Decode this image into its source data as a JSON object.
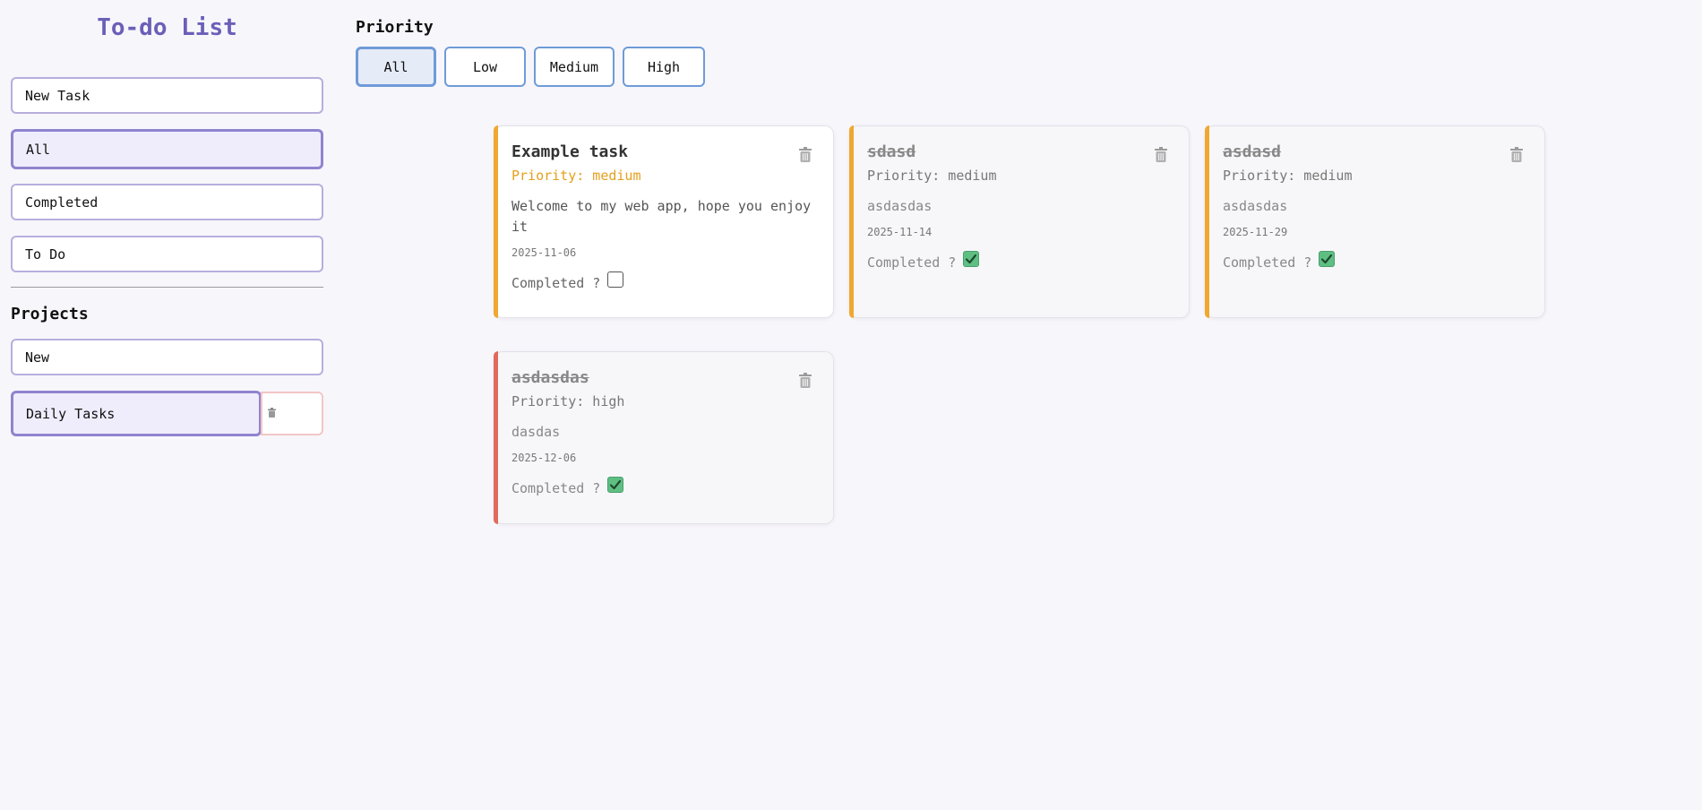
{
  "sidebar": {
    "title": "To-do List",
    "new_task": "New Task",
    "filters": [
      "All",
      "Completed",
      "To Do"
    ],
    "projects_title": "Projects",
    "new_project": "New",
    "project": {
      "label": "Daily Tasks",
      "delete_icon": "trash-icon"
    }
  },
  "priority": {
    "title": "Priority",
    "options": [
      "All",
      "Low",
      "Medium",
      "High"
    ],
    "selected": "All"
  },
  "tasks": [
    {
      "title": "Example task",
      "priority": "Priority: medium",
      "description": "Welcome to my web app, hope you enjoy it",
      "date": "2025-11-06",
      "completed_label": "Completed ?",
      "completed": false,
      "accent": "#f0a830"
    },
    {
      "title": "sdasd",
      "priority": "Priority: medium",
      "description": "asdasdas",
      "date": "2025-11-14",
      "completed_label": "Completed ?",
      "completed": true,
      "accent": "#f0a830"
    },
    {
      "title": "asdasd",
      "priority": "Priority: medium",
      "description": "asdasdas",
      "date": "2025-11-29",
      "completed_label": "Completed ?",
      "completed": true,
      "accent": "#f0a830"
    },
    {
      "title": "asdasdas",
      "priority": "Priority: high",
      "description": "dasdas",
      "date": "2025-12-06",
      "completed_label": "Completed ?",
      "completed": true,
      "accent": "#e06a5c"
    }
  ],
  "colors": {
    "accent": "#6a5fb8",
    "check": "#5fbf83",
    "priority_medium": "#e3a01c"
  }
}
